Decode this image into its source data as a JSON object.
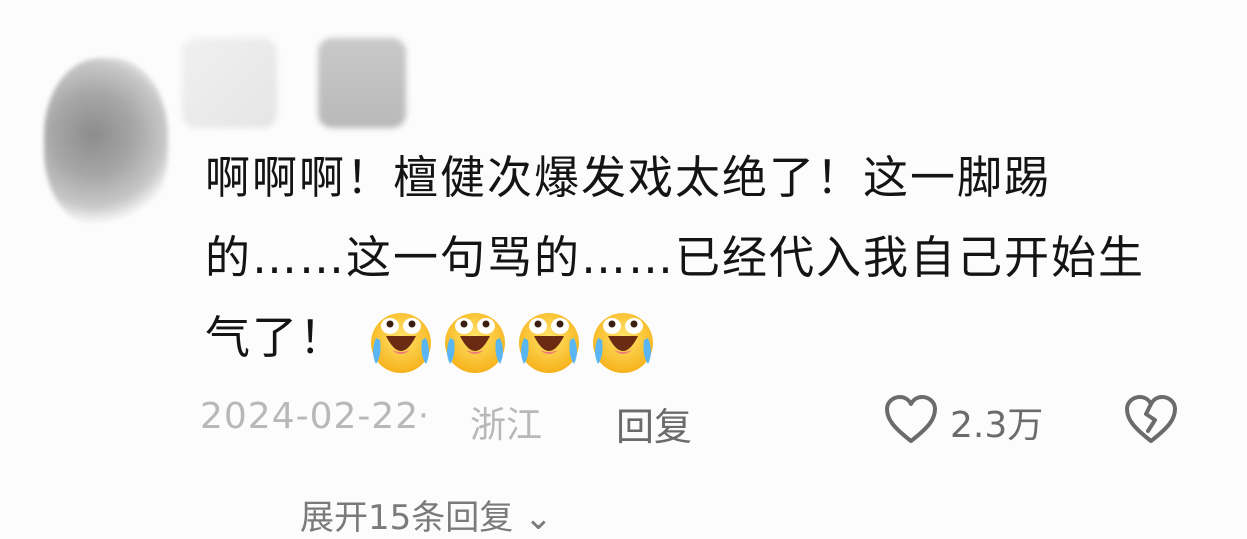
{
  "comment": {
    "text": "啊啊啊！檀健次爆发戏太绝了！这一脚踢的……这一句骂的……已经代入我自己开始生气了！",
    "emoji_name": "crying-laughing-face-emoji",
    "emoji_count": 4
  },
  "meta": {
    "date": "2024-02-22",
    "separator": "·",
    "region": "浙江",
    "reply_label": "回复",
    "like_count": "2.3万"
  },
  "more_replies": "展开15条回复 ⌄",
  "icons": {
    "like": "heart-outline-icon",
    "dislike": "broken-heart-icon"
  },
  "colors": {
    "text": "#141414",
    "meta": "#b8b8b8",
    "action": "#6b6b6b"
  }
}
